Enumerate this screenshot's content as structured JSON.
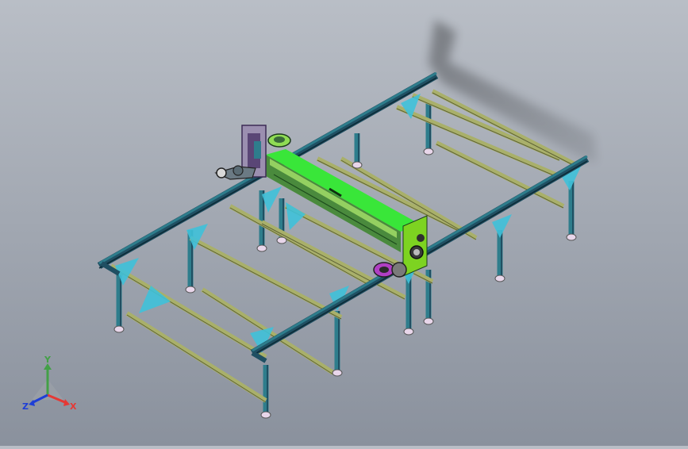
{
  "viewport": {
    "background_top": "#b9bec6",
    "background_bottom": "#8a919d"
  },
  "model": {
    "frame_color": "#2e7d8c",
    "rail_color": "#1f4f62",
    "crossbar_color": "#a9b06a",
    "gusset_color": "#3fc1d9",
    "gantry_color": "#39e639",
    "carriage_color": "#7dd321",
    "accent_color": "#b03fc4",
    "foot_color": "#e8d6ea"
  },
  "triad": {
    "x_label": "X",
    "y_label": "Y",
    "z_label": "Z",
    "x_color": "#e53935",
    "y_color": "#43a047",
    "z_color": "#1e3fd6"
  }
}
